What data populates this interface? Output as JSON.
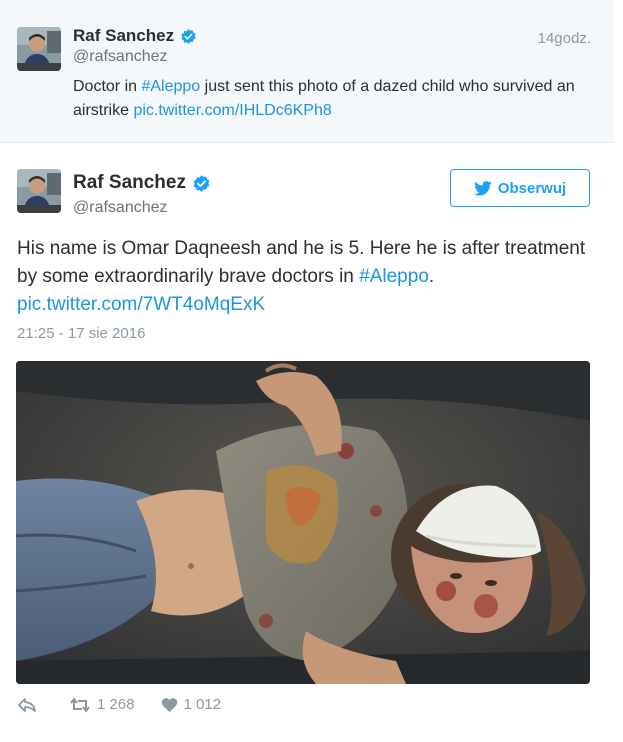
{
  "colors": {
    "link": "#1b95e0",
    "accent": "#1da1f2",
    "muted": "#8899a6",
    "text": "#292f33",
    "parent_bg": "#f5f8fa"
  },
  "parent_tweet": {
    "author": {
      "name": "Raf Sanchez",
      "handle": "@rafsanchez",
      "verified_icon": "verified-badge-icon"
    },
    "time": "14godz.",
    "text": {
      "part1": "Doctor in ",
      "hashtag": "#Aleppo",
      "part2": " just sent this photo of a dazed child who survived an airstrike ",
      "link": "pic.twitter.com/IHLDc6KPh8"
    }
  },
  "main_tweet": {
    "author": {
      "name": "Raf Sanchez",
      "handle": "@rafsanchez",
      "verified_icon": "verified-badge-icon"
    },
    "follow_button": {
      "label": "Obserwuj",
      "icon": "twitter-bird-icon"
    },
    "text": {
      "part1": "His name is Omar Daqneesh and he is 5. Here he is after treatment by some extraordinarily brave doctors in ",
      "hashtag": "#Aleppo",
      "part2": ". ",
      "link": "pic.twitter.com/7WT4oMqExK"
    },
    "timestamp": "21:25 - 17 sie 2016",
    "actions": {
      "reply_icon": "reply-arrow-icon",
      "retweet_icon": "retweet-icon",
      "retweet_count": "1 268",
      "like_icon": "heart-icon",
      "like_count": "1 012"
    }
  }
}
